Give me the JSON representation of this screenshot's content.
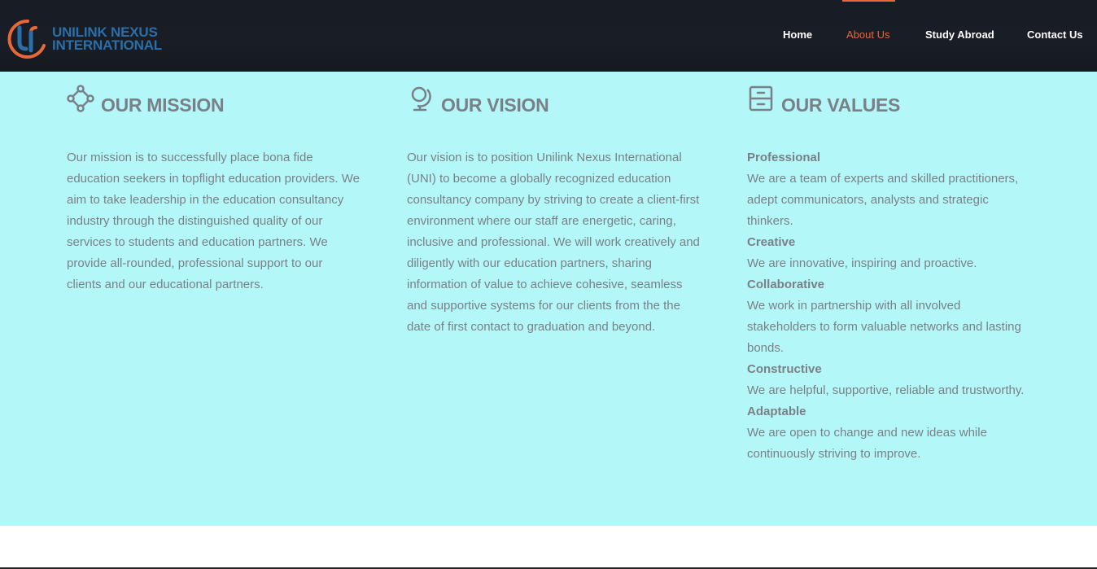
{
  "header": {
    "logo_line1": "UNILINK NEXUS",
    "logo_line2": "INTERNATIONAL",
    "nav": [
      {
        "label": "Home"
      },
      {
        "label": "About Us"
      },
      {
        "label": "Study Abroad"
      },
      {
        "label": "Contact Us"
      }
    ],
    "active_nav": "About Us",
    "colors": {
      "bg": "#181c24",
      "accent": "#e8683a",
      "logo_blue": "#2a6fa8"
    }
  },
  "mission": {
    "title": "OUR MISSION",
    "icon": "diamond-nodes-icon",
    "text": "Our mission is to successfully place bona fide education seekers in topflight education providers. We aim to take leadership in the education consultancy industry through the distinguished quality of our services to students and education partners. We provide all-rounded, professional support to our clients and our educational partners."
  },
  "vision": {
    "title": "OUR VISION",
    "icon": "globe-icon",
    "text": "Our vision is to position Unilink Nexus International (UNI) to become a globally recognized education consultancy company by striving to create a client-first environment where our staff are energetic, caring, inclusive and professional. We will work creatively and diligently with our education partners, sharing information of value to achieve cohesive, seamless and supportive systems for our clients from the the date of first contact to graduation and beyond."
  },
  "values": {
    "title": "OUR VALUES",
    "icon": "cabinet-icon",
    "items": [
      {
        "heading": "Professional",
        "text": "We are a team of experts and skilled practitioners, adept communicators, analysts and strategic thinkers."
      },
      {
        "heading": "Creative",
        "text": "We are innovative, inspiring and proactive."
      },
      {
        "heading": "Collaborative",
        "text": "We work in partnership with all involved stakeholders to form valuable networks and lasting bonds."
      },
      {
        "heading": "Constructive",
        "text": "We are helpful, supportive, reliable and trustworthy."
      },
      {
        "heading": "Adaptable",
        "text": "We are open to change and new ideas while continuously striving to improve."
      }
    ]
  },
  "section_bg": "#b3f7f9",
  "text_color": "#7b8088"
}
